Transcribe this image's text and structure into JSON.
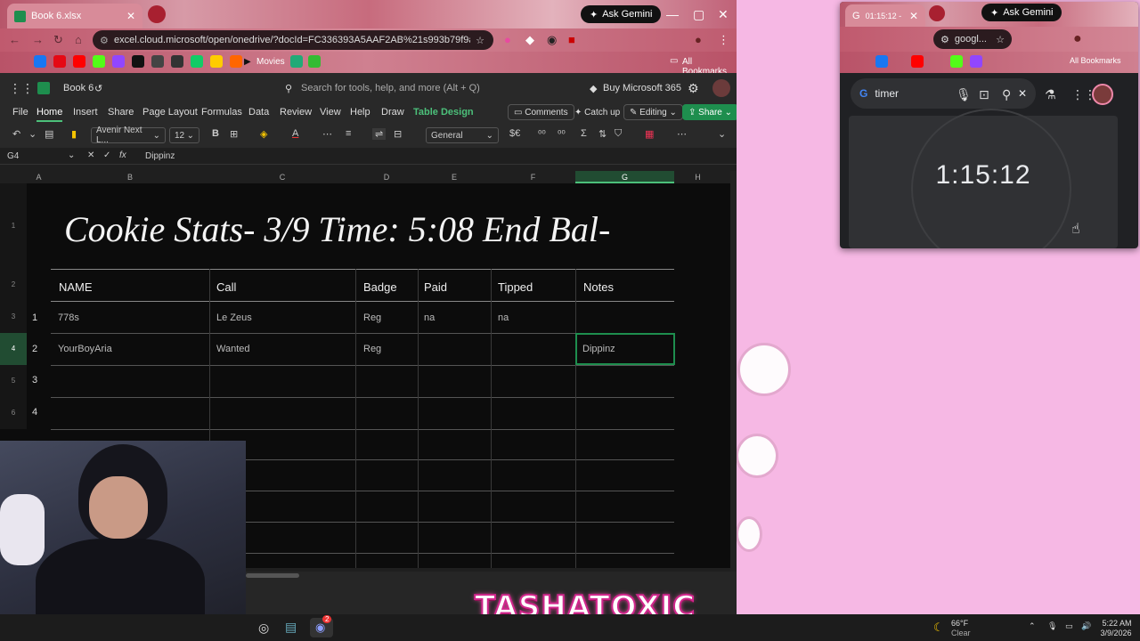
{
  "excel_browser": {
    "tab_title": "Book 6.xlsx",
    "gemini_label": "Ask Gemini",
    "url": "excel.cloud.microsoft/open/onedrive/?docId=FC336393A5AAF2AB%21s993b79f9af8146d1a33...",
    "bookmarks": {
      "movies": "Movies",
      "all": "All Bookmarks"
    }
  },
  "excel": {
    "file_name": "Book 6",
    "search_placeholder": "Search for tools, help, and more (Alt + Q)",
    "buy_label": "Buy Microsoft 365",
    "ribbon_tabs": [
      "File",
      "Home",
      "Insert",
      "Share",
      "Page Layout",
      "Formulas",
      "Data",
      "Review",
      "View",
      "Help",
      "Draw",
      "Table Design"
    ],
    "comments_label": "Comments",
    "catchup_label": "Catch up",
    "editing_label": "Editing",
    "share_label": "Share",
    "font_name": "Avenir Next L...",
    "font_size": "12",
    "number_format": "General",
    "name_box": "G4",
    "formula_value": "Dippinz",
    "columns": [
      "A",
      "B",
      "C",
      "D",
      "E",
      "F",
      "G",
      "H"
    ],
    "title": "Cookie Stats- 3/9 Time: 5:08 End Bal-",
    "headers": [
      "NAME",
      "Call",
      "Badge",
      "Paid",
      "Tipped",
      "Notes"
    ],
    "rows": [
      {
        "row": "3",
        "num": "1",
        "name": "778s",
        "call": "Le Zeus",
        "badge": "Reg",
        "paid": "na",
        "tipped": "na",
        "notes": ""
      },
      {
        "row": "4",
        "num": "2",
        "name": "YourBoyAria",
        "call": "Wanted",
        "badge": "Reg",
        "paid": "",
        "tipped": "",
        "notes": "Dippinz"
      },
      {
        "row": "5",
        "num": "3",
        "name": "",
        "call": "",
        "badge": "",
        "paid": "",
        "tipped": "",
        "notes": ""
      },
      {
        "row": "6",
        "num": "4",
        "name": "",
        "call": "",
        "badge": "",
        "paid": "",
        "tipped": "",
        "notes": ""
      }
    ],
    "row_labels": [
      "1",
      "2"
    ]
  },
  "timer_browser": {
    "tab_title": "01:15:12 - G",
    "gemini_label": "Ask Gemini",
    "address": "googl...",
    "bookmarks_label": "All Bookmarks",
    "search_value": "timer",
    "timer_value": "1:15:12"
  },
  "taskbar": {
    "weather_temp": "66°F",
    "weather_desc": "Clear",
    "time": "5:22 AM",
    "date": "3/9/2026",
    "discord_badge": "2"
  },
  "overlay_text": "TASHATOXIC",
  "colors": {
    "excel_green": "#1e8e4e",
    "tab_accent": "#4cc07a",
    "desktop_pink": "#f6b8e4"
  }
}
